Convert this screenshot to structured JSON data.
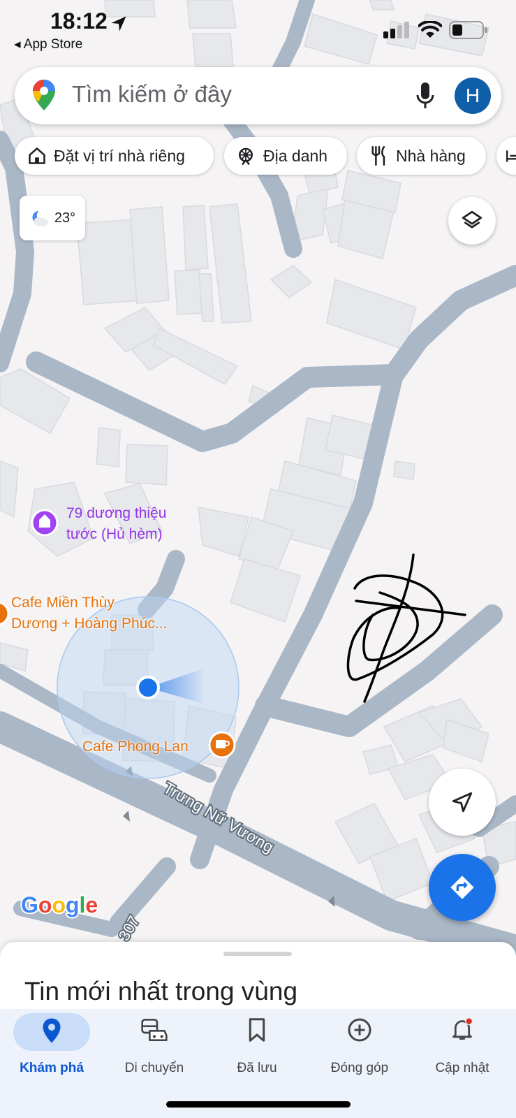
{
  "status_bar": {
    "time": "18:12",
    "back_app": "◂ App Store"
  },
  "search": {
    "placeholder": "Tìm kiếm ở đây",
    "avatar_initial": "H"
  },
  "chips": [
    {
      "label": "Đặt vị trí nhà riêng",
      "icon": "home-icon"
    },
    {
      "label": "Địa danh",
      "icon": "landmark-icon"
    },
    {
      "label": "Nhà hàng",
      "icon": "restaurant-icon"
    }
  ],
  "weather": {
    "temperature": "23°",
    "icon": "moon-cloud-icon"
  },
  "map": {
    "places": [
      {
        "name": "79 dương thiệu\ntước (Hủ hèm)",
        "icon": "attraction-pin-icon",
        "color": "#9334e6"
      },
      {
        "name": "Cafe Miền Thùy\nDương + Hoàng Phúc...",
        "icon": "cafe-pin-icon",
        "color": "#e8710a"
      },
      {
        "name": "Cafe Phong Lan",
        "icon": "cafe-pin-icon",
        "color": "#e8710a"
      }
    ],
    "street_names": [
      "Trưng Nữ Vương",
      "307"
    ],
    "attribution": "Google",
    "accent": "#1a73e8"
  },
  "sheet": {
    "title": "Tin mới nhất trong vùng"
  },
  "nav": {
    "items": [
      {
        "label": "Khám phá",
        "icon": "explore-pin-icon",
        "active": true
      },
      {
        "label": "Di chuyển",
        "icon": "commute-icon",
        "active": false
      },
      {
        "label": "Đã lưu",
        "icon": "bookmark-icon",
        "active": false
      },
      {
        "label": "Đóng góp",
        "icon": "add-circle-icon",
        "active": false
      },
      {
        "label": "Cập nhật",
        "icon": "bell-icon",
        "active": false
      }
    ]
  }
}
